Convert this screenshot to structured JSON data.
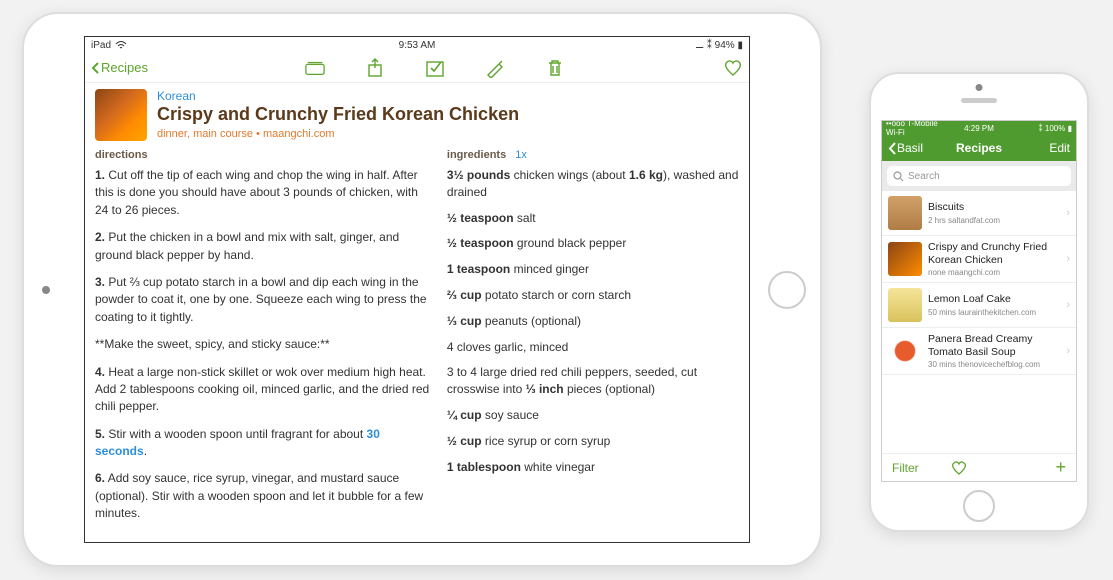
{
  "ipad": {
    "status": {
      "device": "iPad",
      "time": "9:53 AM",
      "battery": "94%"
    },
    "nav": {
      "back": "Recipes"
    },
    "recipe": {
      "category": "Korean",
      "title": "Crispy and Crunchy Fried Korean Chicken",
      "tags": "dinner, main course • maangchi.com",
      "directions_label": "directions",
      "ingredients_label": "ingredients",
      "multiplier": "1x",
      "directions": [
        {
          "num": "1.",
          "text": " Cut off the tip of each wing and chop the wing in half. After this is done you should have about 3 pounds of chicken, with 24 to 26 pieces."
        },
        {
          "num": "2.",
          "text": " Put the chicken in a bowl and mix with salt, ginger, and ground black pepper by hand."
        },
        {
          "num": "3.",
          "text": " Put ⅔ cup potato starch in a bowl and dip each wing in the powder to coat it, one by one. Squeeze each wing to press the coating to it tightly."
        },
        {
          "num": "",
          "text": "**Make the sweet, spicy, and sticky sauce:**"
        },
        {
          "num": "4.",
          "text": " Heat a large non-stick skillet or wok over medium high heat. Add 2 tablespoons cooking oil, minced garlic, and the dried red chili pepper."
        },
        {
          "num": "5.",
          "text": " Stir with a wooden spoon until fragrant for about ",
          "hl": "30 seconds",
          "tail": "."
        },
        {
          "num": "6.",
          "text": " Add soy sauce, rice syrup, vinegar, and mustard sauce (optional). Stir with a wooden spoon and let it bubble for a few minutes."
        }
      ],
      "ingredients": [
        {
          "amt": "3½ pounds",
          "rest": " chicken wings (about ",
          "b2": "1.6 kg",
          "tail": "), washed and drained"
        },
        {
          "amt": "½ teaspoon",
          "rest": " salt"
        },
        {
          "amt": "½ teaspoon",
          "rest": " ground black pepper"
        },
        {
          "amt": "1 teaspoon",
          "rest": " minced ginger"
        },
        {
          "amt": "⅔ cup",
          "rest": " potato starch or corn starch"
        },
        {
          "amt": "⅓ cup",
          "rest": " peanuts (optional)"
        },
        {
          "amt": "",
          "rest": "4 cloves garlic, minced"
        },
        {
          "amt": "",
          "rest": "3 to 4 large dried red chili peppers, seeded, cut crosswise into ",
          "b2": "⅓ inch",
          "tail": " pieces (optional)"
        },
        {
          "amt": "¼ cup",
          "rest": " soy sauce"
        },
        {
          "amt": "½ cup",
          "rest": " rice syrup or corn syrup"
        },
        {
          "amt": "1 tablespoon",
          "rest": " white vinegar"
        }
      ]
    }
  },
  "iphone": {
    "status": {
      "carrier": "T-Mobile Wi-Fi",
      "time": "4:29 PM",
      "battery": "100%"
    },
    "nav": {
      "back": "Basil",
      "title": "Recipes",
      "edit": "Edit"
    },
    "search_placeholder": "Search",
    "list": [
      {
        "name": "Biscuits",
        "sub": "2 hrs  saltandfat.com",
        "thumb": "th-biscuit"
      },
      {
        "name": "Crispy and Crunchy Fried Korean Chicken",
        "sub": "none  maangchi.com",
        "thumb": "th-chicken"
      },
      {
        "name": "Lemon Loaf Cake",
        "sub": "50 mins  laurainthekitchen.com",
        "thumb": "th-lemon"
      },
      {
        "name": "Panera Bread Creamy Tomato Basil Soup",
        "sub": "30 mins  thenovicechefblog.com",
        "thumb": "th-tomato"
      }
    ],
    "toolbar": {
      "filter": "Filter",
      "add": "+"
    }
  }
}
